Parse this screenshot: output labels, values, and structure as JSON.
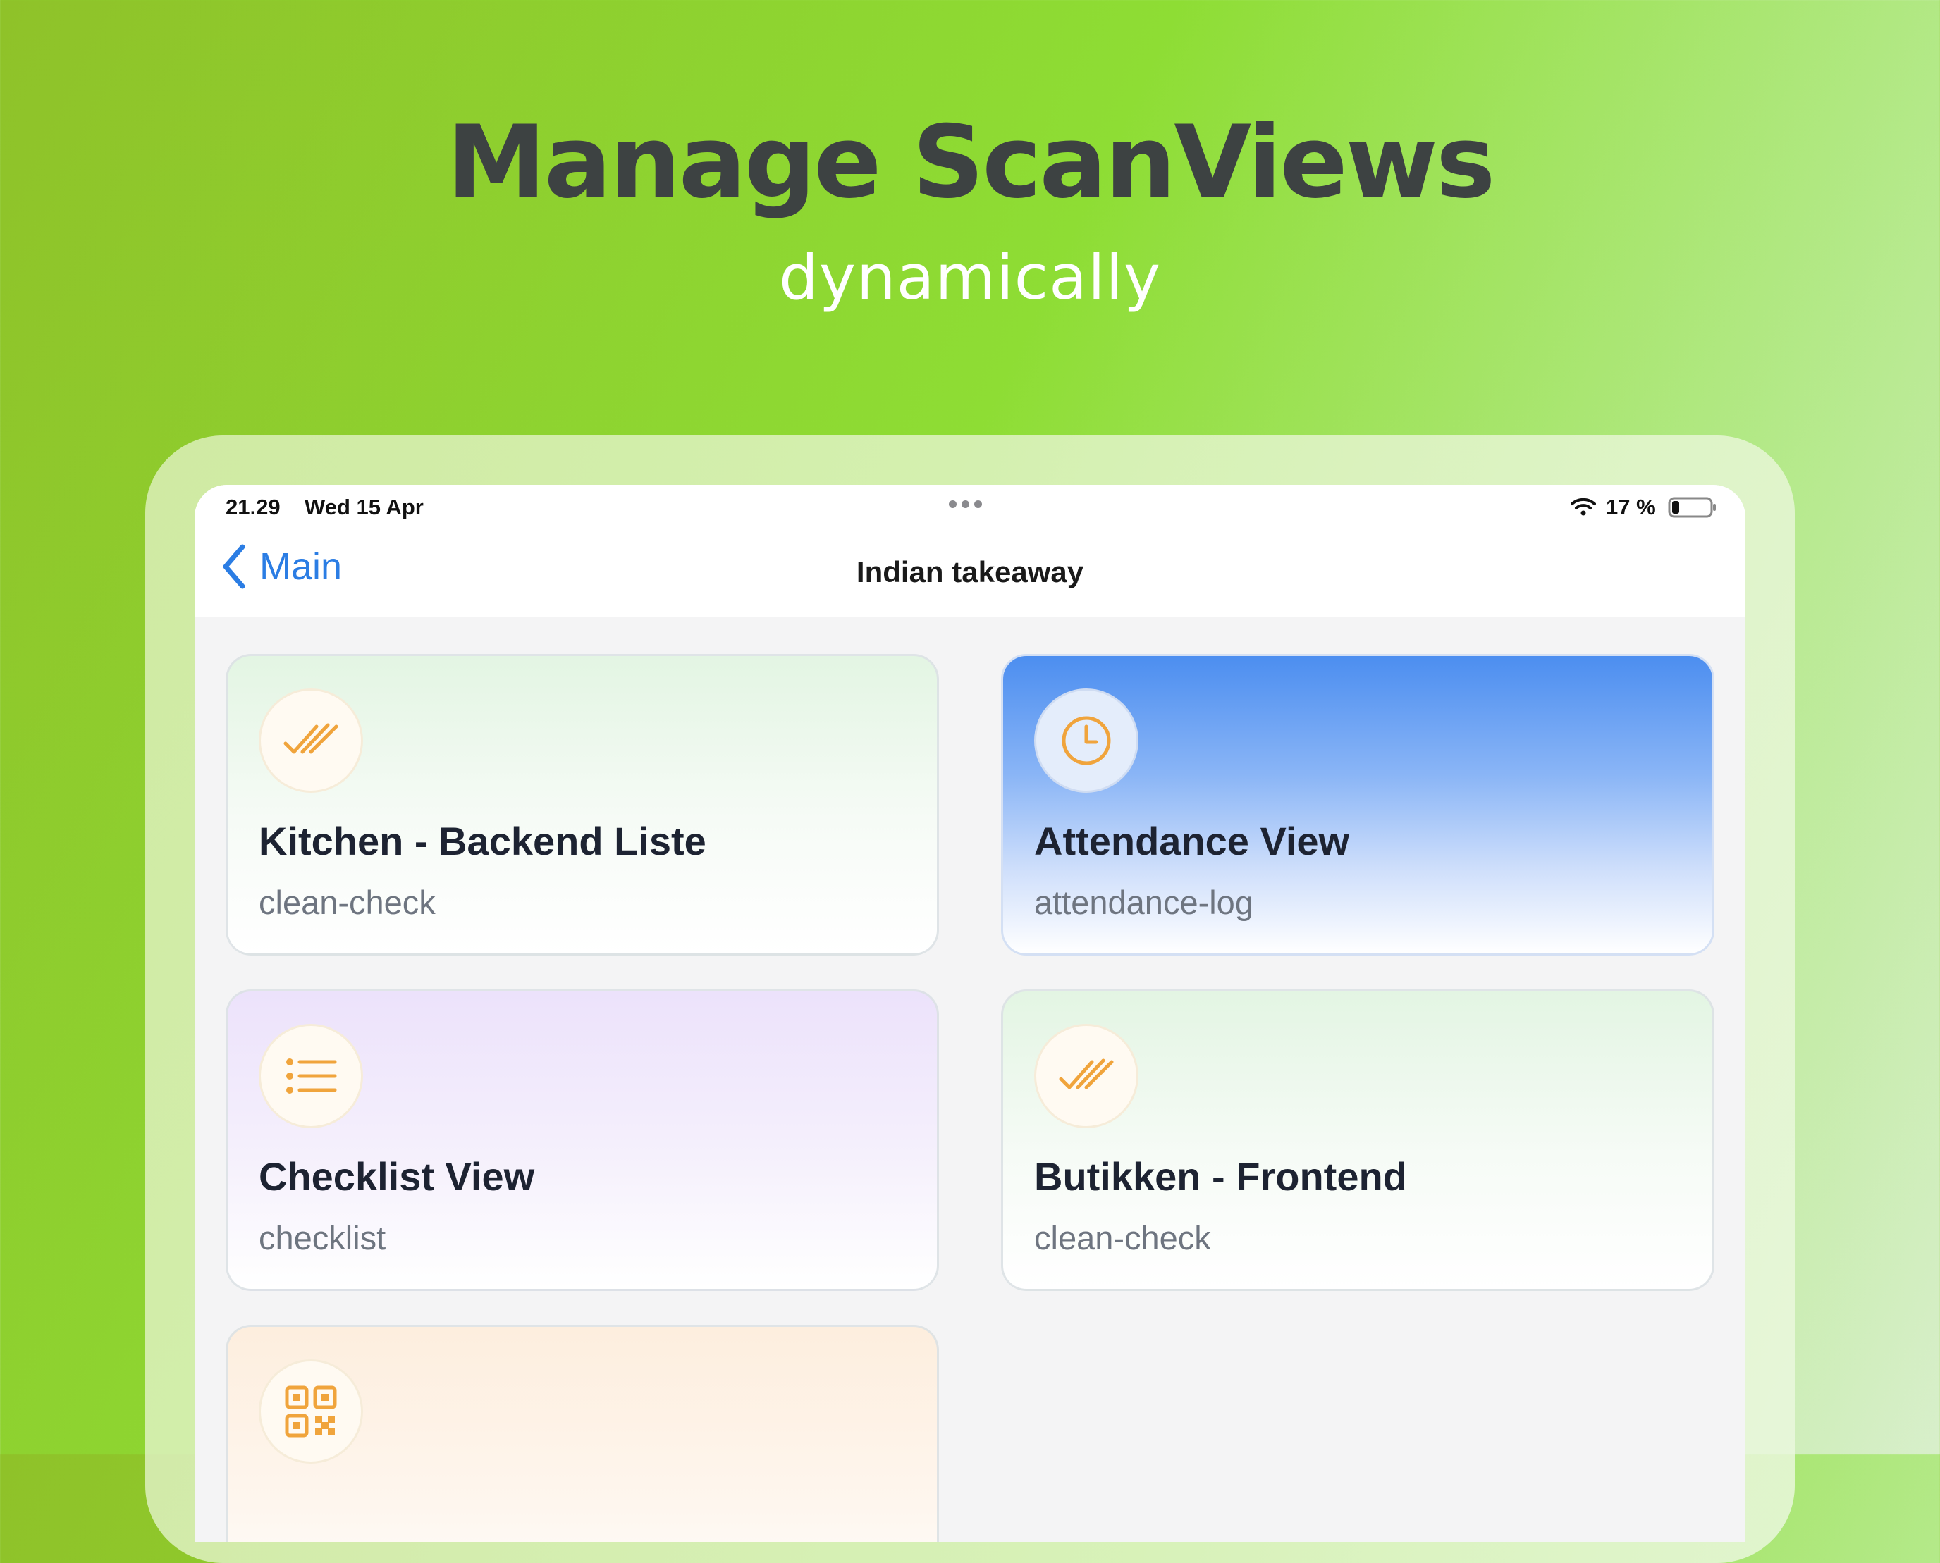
{
  "hero": {
    "title": "Manage ScanViews",
    "subtitle": "dynamically"
  },
  "status_bar": {
    "time": "21.29",
    "date": "Wed 15 Apr",
    "battery": "17 %"
  },
  "nav": {
    "back_label": "Main",
    "title": "Indian takeaway"
  },
  "cards": [
    {
      "title": "Kitchen - Backend Liste",
      "subtitle": "clean-check",
      "icon": "double-check-icon",
      "theme": "green"
    },
    {
      "title": "Attendance View",
      "subtitle": "attendance-log",
      "icon": "clock-icon",
      "theme": "blue"
    },
    {
      "title": "Checklist View",
      "subtitle": "checklist",
      "icon": "list-icon",
      "theme": "purple"
    },
    {
      "title": "Butikken - Frontend",
      "subtitle": "clean-check",
      "icon": "double-check-icon",
      "theme": "green"
    },
    {
      "title": "",
      "subtitle": "",
      "icon": "qr-code-icon",
      "theme": "peach"
    }
  ],
  "colors": {
    "accent": "#2b7de4",
    "icon_orange": "#f0a43c",
    "headline": "#3d4242"
  }
}
